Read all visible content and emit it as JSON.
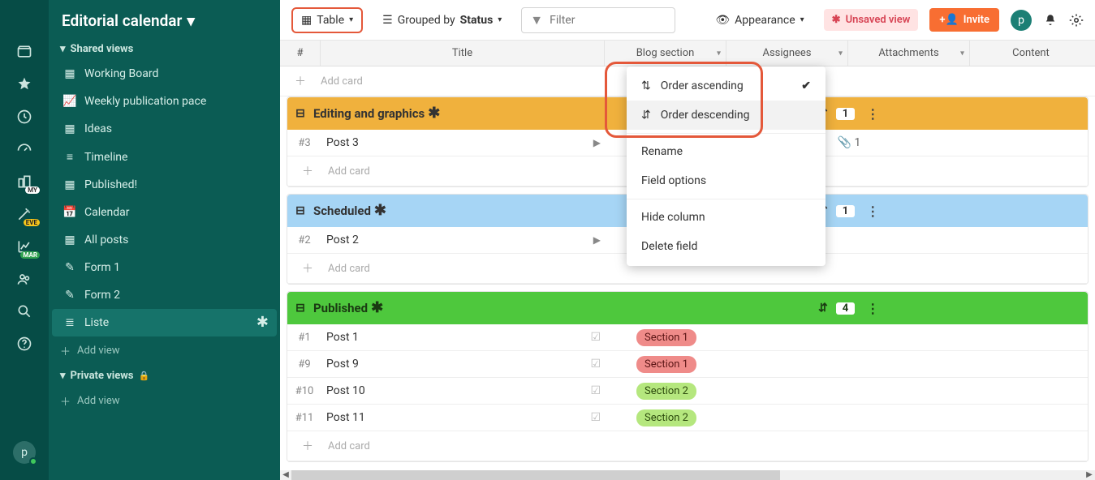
{
  "board": {
    "title": "Editorial calendar"
  },
  "rail": {
    "badges": {
      "my": "MY",
      "eve": "EVE",
      "mar": "MAR"
    },
    "avatar": "p"
  },
  "sidebar": {
    "shared_label": "Shared views",
    "items": [
      {
        "icon": "board",
        "label": "Working Board"
      },
      {
        "icon": "chart",
        "label": "Weekly publication pace"
      },
      {
        "icon": "table",
        "label": "Ideas"
      },
      {
        "icon": "timeline",
        "label": "Timeline"
      },
      {
        "icon": "table",
        "label": "Published!"
      },
      {
        "icon": "calendar",
        "label": "Calendar"
      },
      {
        "icon": "table",
        "label": "All posts"
      },
      {
        "icon": "form",
        "label": "Form 1"
      },
      {
        "icon": "form",
        "label": "Form 2"
      },
      {
        "icon": "list",
        "label": "Liste",
        "active": true,
        "asterisk": true
      }
    ],
    "add_view": "Add view",
    "private_label": "Private views"
  },
  "toolbar": {
    "table_label": "Table",
    "grouped_prefix": "Grouped by ",
    "grouped_value": "Status",
    "filter_placeholder": "Filter",
    "appearance_label": "Appearance",
    "unsaved_label": "Unsaved view",
    "invite_label": "Invite",
    "avatar": "p"
  },
  "columns": {
    "hash": "#",
    "title": "Title",
    "blog": "Blog section",
    "assignees": "Assignees",
    "attachments": "Attachments",
    "content": "Content"
  },
  "add_card": "Add card",
  "groups": [
    {
      "name": "Editing and graphics",
      "color": "orange",
      "count": "1",
      "rows": [
        {
          "hash": "#3",
          "title": "Post 3",
          "play": true,
          "attach": "1"
        }
      ]
    },
    {
      "name": "Scheduled",
      "color": "blue",
      "count": "1",
      "rows": [
        {
          "hash": "#2",
          "title": "Post 2",
          "play": true
        }
      ]
    },
    {
      "name": "Published",
      "color": "green",
      "count": "4",
      "rows": [
        {
          "hash": "#1",
          "title": "Post 1",
          "check": true,
          "blog": "Section 1",
          "blog_color": "red"
        },
        {
          "hash": "#9",
          "title": "Post 9",
          "check": true,
          "blog": "Section 1",
          "blog_color": "red"
        },
        {
          "hash": "#10",
          "title": "Post 10",
          "check": true,
          "blog": "Section 2",
          "blog_color": "green"
        },
        {
          "hash": "#11",
          "title": "Post 11",
          "check": true,
          "blog": "Section 2",
          "blog_color": "green"
        }
      ]
    }
  ],
  "dropdown": {
    "order_asc": "Order ascending",
    "order_desc": "Order descending",
    "rename": "Rename",
    "field_options": "Field options",
    "hide": "Hide column",
    "delete": "Delete field"
  }
}
